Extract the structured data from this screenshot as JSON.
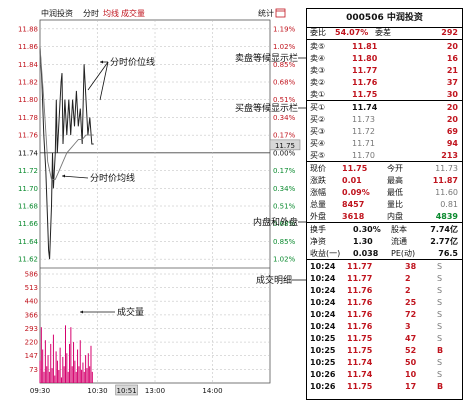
{
  "toolbar": {
    "title": "中润投资",
    "tab_time": "分时",
    "tab_avg": "均线",
    "tab_volume": "成交量",
    "stats_label": "统计",
    "stats_icon": "window-icon"
  },
  "chart_data": [
    {
      "type": "line",
      "title": "",
      "x_ticks": [
        "09:30",
        "10:30",
        "10:51",
        "13:00",
        "14:00"
      ],
      "price_ticks": [
        "11.88",
        "11.86",
        "11.84",
        "11.82",
        "11.80",
        "11.78",
        "11.76",
        "11.74",
        "11.72",
        "11.70",
        "11.68",
        "11.66",
        "11.64",
        "11.62"
      ],
      "pct_ticks": [
        "1.19%",
        "1.02%",
        "0.85%",
        "0.68%",
        "0.51%",
        "0.34%",
        "0.17%",
        "0.00%",
        "0.17%",
        "0.34%",
        "0.51%",
        "0.68%",
        "0.85%",
        "1.02%"
      ],
      "ylim": [
        11.61,
        11.89
      ],
      "reference_price": 11.74,
      "cursor_price_label": "11.75",
      "series": [
        {
          "x": [
            "09:30",
            "09:32",
            "09:34",
            "09:36",
            "09:38",
            "09:39",
            "09:40",
            "09:42",
            "09:43",
            "09:44",
            "09:46",
            "09:47",
            "09:48",
            "09:50",
            "09:52",
            "09:53",
            "09:54",
            "09:56",
            "09:58",
            "10:00",
            "10:02",
            "10:04",
            "10:06",
            "10:08",
            "10:10",
            "10:12",
            "10:14",
            "10:16",
            "10:18",
            "10:20",
            "10:22",
            "10:24",
            "10:26"
          ],
          "values": [
            11.86,
            11.82,
            11.76,
            11.72,
            11.66,
            11.63,
            11.62,
            11.68,
            11.74,
            11.7,
            11.74,
            11.8,
            11.74,
            11.78,
            11.82,
            11.83,
            11.75,
            11.8,
            11.76,
            11.8,
            11.76,
            11.8,
            11.77,
            11.81,
            11.77,
            11.79,
            11.75,
            11.84,
            11.8,
            11.76,
            11.78,
            11.75,
            11.75
          ]
        },
        {
          "x": [
            "09:30",
            "09:34",
            "09:38",
            "09:42",
            "09:46",
            "09:50",
            "09:54",
            "09:58",
            "10:02",
            "10:06",
            "10:10",
            "10:14",
            "10:18",
            "10:22",
            "10:26"
          ],
          "values": [
            11.86,
            11.8,
            11.73,
            11.71,
            11.71,
            11.72,
            11.73,
            11.74,
            11.745,
            11.75,
            11.755,
            11.755,
            11.76,
            11.76,
            11.76
          ]
        }
      ]
    },
    {
      "type": "bar",
      "title": "",
      "y_ticks": [
        "586",
        "513",
        "440",
        "366",
        "293",
        "220",
        "147",
        "73"
      ],
      "ylim": [
        0,
        586
      ],
      "values": [
        120,
        300,
        180,
        60,
        230,
        90,
        150,
        60,
        210,
        80,
        260,
        40,
        170,
        120,
        70,
        190,
        30,
        140,
        90,
        310,
        160,
        60,
        210,
        300,
        90,
        220,
        120,
        60,
        180,
        90,
        230,
        70,
        110,
        60,
        150,
        80,
        160,
        90,
        200,
        60
      ]
    }
  ],
  "annotations": {
    "price_line": "分时价位线",
    "avg_line": "分时价均线",
    "sell_board": "卖盘等候显示栏",
    "buy_board": "买盘等候显示栏",
    "inner_outer": "内盘和外盘",
    "trade_details": "成交明细",
    "volume": "成交量"
  },
  "panel": {
    "title": "000506 中润投资",
    "ratio_label": "委比",
    "ratio_value": "54.07%",
    "diff_label": "委差",
    "diff_value": "292",
    "asks": [
      {
        "label": "卖⑤",
        "price": "11.81",
        "volume": "20"
      },
      {
        "label": "卖④",
        "price": "11.80",
        "volume": "16"
      },
      {
        "label": "卖③",
        "price": "11.77",
        "volume": "21"
      },
      {
        "label": "卖②",
        "price": "11.76",
        "volume": "37"
      },
      {
        "label": "卖①",
        "price": "11.75",
        "volume": "30"
      }
    ],
    "bids": [
      {
        "label": "买①",
        "price": "11.74",
        "volume": "20"
      },
      {
        "label": "买②",
        "price": "11.73",
        "volume": "20"
      },
      {
        "label": "买③",
        "price": "11.72",
        "volume": "69"
      },
      {
        "label": "买④",
        "price": "11.71",
        "volume": "94"
      },
      {
        "label": "买⑤",
        "price": "11.70",
        "volume": "213"
      }
    ],
    "quote": [
      {
        "l1": "现价",
        "v1": "11.75",
        "l2": "今开",
        "v2": "11.73"
      },
      {
        "l1": "涨跌",
        "v1": "0.01",
        "l2": "最高",
        "v2": "11.87"
      },
      {
        "l1": "涨幅",
        "v1": "0.09%",
        "l2": "最低",
        "v2": "11.60"
      },
      {
        "l1": "总量",
        "v1": "8457",
        "l2": "量比",
        "v2": "0.81"
      },
      {
        "l1": "外盘",
        "v1": "3618",
        "l2": "内盘",
        "v2": "4839"
      }
    ],
    "stats": [
      {
        "l1": "换手",
        "v1": "0.30%",
        "l2": "股本",
        "v2": "7.74亿"
      },
      {
        "l1": "净资",
        "v1": "1.30",
        "l2": "流通",
        "v2": "2.77亿"
      },
      {
        "l1": "收益(一)",
        "v1": "0.038",
        "l2": "PE(动)",
        "v2": "76.5"
      }
    ],
    "trades": [
      {
        "time": "10:24",
        "price": "11.77",
        "vol": "38",
        "side": "S"
      },
      {
        "time": "10:24",
        "price": "11.77",
        "vol": "2",
        "side": "S"
      },
      {
        "time": "10:24",
        "price": "11.76",
        "vol": "2",
        "side": "S"
      },
      {
        "time": "10:24",
        "price": "11.76",
        "vol": "25",
        "side": "S"
      },
      {
        "time": "10:24",
        "price": "11.76",
        "vol": "72",
        "side": "S"
      },
      {
        "time": "10:24",
        "price": "11.76",
        "vol": "3",
        "side": "S"
      },
      {
        "time": "10:25",
        "price": "11.75",
        "vol": "47",
        "side": "S"
      },
      {
        "time": "10:25",
        "price": "11.75",
        "vol": "52",
        "side": "B"
      },
      {
        "time": "10:25",
        "price": "11.74",
        "vol": "50",
        "side": "S"
      },
      {
        "time": "10:26",
        "price": "11.74",
        "vol": "10",
        "side": "S"
      },
      {
        "time": "10:26",
        "price": "11.75",
        "vol": "17",
        "side": "B"
      }
    ]
  },
  "colors": {
    "up": "#c0141e",
    "down": "#0a8a2e",
    "price_line": "#222222",
    "avg_line": "#777777",
    "volume_bar": "#d5006d",
    "grid": "#b8b8b8"
  }
}
